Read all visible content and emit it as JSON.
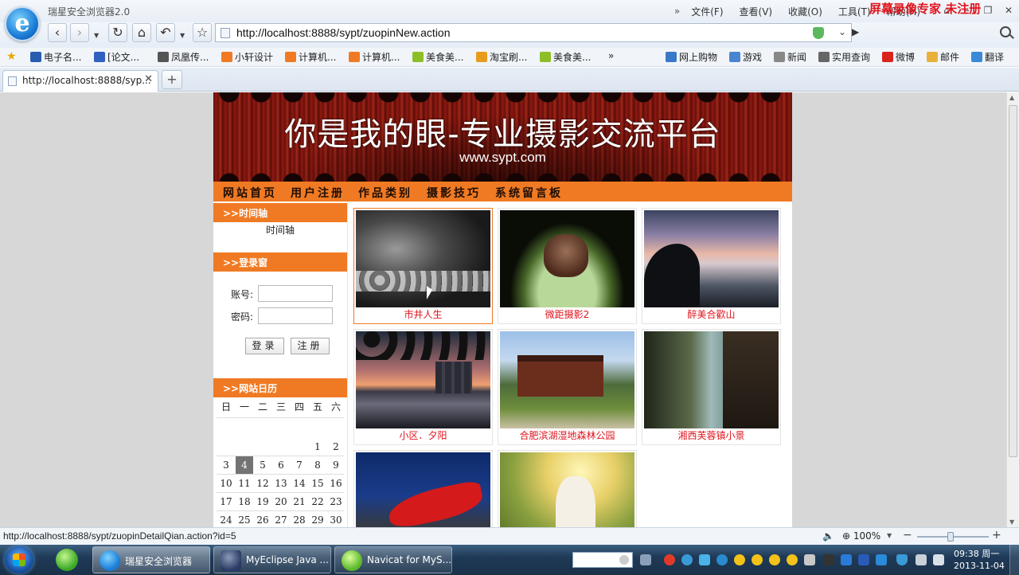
{
  "browser": {
    "title": "瑞星安全浏览器2.0",
    "menu": [
      "文件(F)",
      "查看(V)",
      "收藏(O)",
      "工具(T)",
      "帮助(H)"
    ],
    "url": "http://localhost:8888/sypt/zuopinNew.action",
    "watermark": "屏幕录像专家  未注册",
    "favorites": [
      "电子名...",
      "[论文...",
      "凤凰传...",
      "小轩设计",
      "计算机...",
      "计算机...",
      "美食美...",
      "淘宝刷...",
      "美食美...",
      "网上购物",
      "游戏",
      "新闻",
      "实用查询",
      "微博",
      "邮件",
      "翻译"
    ],
    "tab_title": "http://localhost:8888/syp...",
    "status_url": "http://localhost:8888/sypt/zuopinDetailQian.action?id=5",
    "zoom": "100%"
  },
  "site": {
    "banner_title": "你是我的眼-专业摄影交流平台",
    "banner_url": "www.sypt.com",
    "nav": [
      "网站首页",
      "用户注册",
      "作品类别",
      "摄影技巧",
      "系统留言板"
    ],
    "timeline": {
      "header": ">>时间轴",
      "text": "时间轴"
    },
    "login": {
      "header": ">>登录窗",
      "account_label": "账号:",
      "password_label": "密码:",
      "account_value": "",
      "password_value": "",
      "login_button": "登录",
      "register_button": "注册"
    },
    "calendar": {
      "header": ">>网站日历",
      "weekdays": [
        "日",
        "一",
        "二",
        "三",
        "四",
        "五",
        "六"
      ],
      "weeks": [
        [
          "",
          "",
          "",
          "",
          "",
          "1",
          "2"
        ],
        [
          "3",
          "4",
          "5",
          "6",
          "7",
          "8",
          "9"
        ],
        [
          "10",
          "11",
          "12",
          "13",
          "14",
          "15",
          "16"
        ],
        [
          "17",
          "18",
          "19",
          "20",
          "21",
          "22",
          "23"
        ],
        [
          "24",
          "25",
          "26",
          "27",
          "28",
          "29",
          "30"
        ]
      ],
      "today": "4"
    },
    "works": [
      {
        "caption": "市井人生",
        "active": true
      },
      {
        "caption": "微距摄影2"
      },
      {
        "caption": "醉美合歡山"
      },
      {
        "caption": "小区．夕阳"
      },
      {
        "caption": "合肥滨湖湿地森林公园"
      },
      {
        "caption": "湘西芙蓉镇小景"
      },
      {
        "caption": ""
      },
      {
        "caption": ""
      }
    ]
  },
  "taskbar": {
    "tasks": [
      "瑞星安全浏览器",
      "MyEclipse Java ...",
      "Navicat for MyS..."
    ],
    "time": "09:38 周一",
    "date": "2013-11-04"
  }
}
